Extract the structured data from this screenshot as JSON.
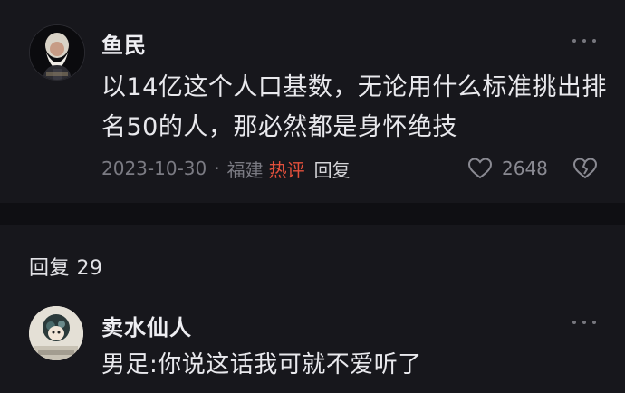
{
  "main_comment": {
    "username": "鱼民",
    "text": "以14亿这个人口基数，无论用什么标准挑出排名50的人，那必然都是身怀绝技",
    "date": "2023-10-30",
    "separator": "·",
    "location": "福建",
    "hot_label": "热评",
    "reply_label": "回复",
    "like_count": "2648",
    "avatar_icon": "bearded-man-portrait",
    "hot_color": "#e3503c"
  },
  "replies_section": {
    "header": "回复 29",
    "items": [
      {
        "username": "卖水仙人",
        "text": "男足:你说这话我可就不爱听了",
        "avatar_icon": "cartoon-avatar"
      }
    ]
  }
}
